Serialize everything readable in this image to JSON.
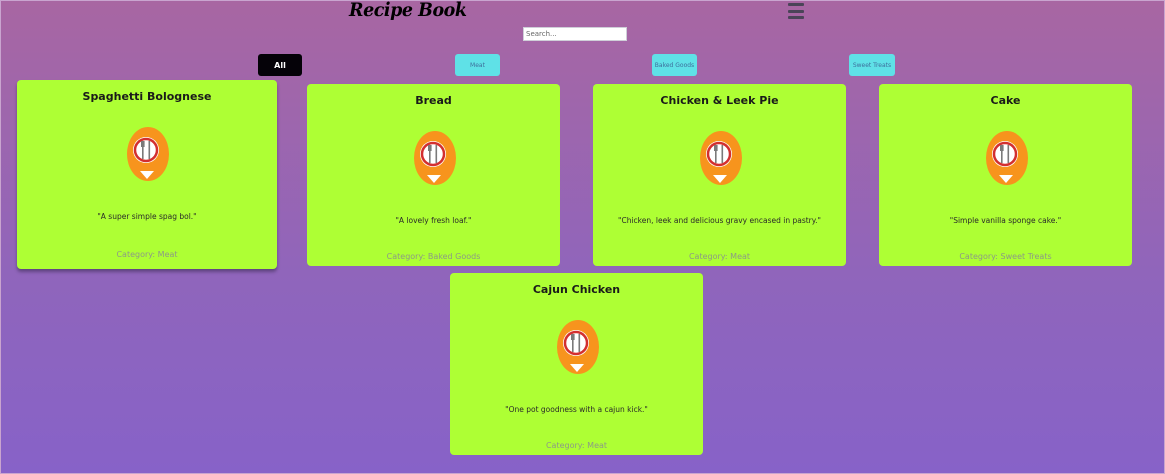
{
  "header": {
    "title": "Recipe Book",
    "menu_icon": "hamburger-menu-icon"
  },
  "search": {
    "placeholder": "Search...",
    "value": ""
  },
  "filters": [
    {
      "label": "All",
      "active": true
    },
    {
      "label": "Meat",
      "active": false
    },
    {
      "label": "Baked Goods",
      "active": false
    },
    {
      "label": "Sweet Treats",
      "active": false
    }
  ],
  "recipes": [
    {
      "name": "Spaghetti Bolognese",
      "description": "\"A super simple spag bol.\"",
      "category": "Category: Meat",
      "icon": "plate-cutlery-pin-icon"
    },
    {
      "name": "Bread",
      "description": "\"A lovely fresh loaf.\"",
      "category": "Category: Baked Goods",
      "icon": "plate-cutlery-pin-icon"
    },
    {
      "name": "Chicken & Leek Pie",
      "description": "\"Chicken, leek and delicious gravy encased in pastry.\"",
      "category": "Category: Meat",
      "icon": "plate-cutlery-pin-icon"
    },
    {
      "name": "Cake",
      "description": "\"Simple vanilla sponge cake.\"",
      "category": "Category: Sweet Treats",
      "icon": "plate-cutlery-pin-icon"
    },
    {
      "name": "Cajun Chicken",
      "description": "\"One pot goodness with a cajun kick.\"",
      "category": "Category: Meat",
      "icon": "plate-cutlery-pin-icon"
    }
  ],
  "colors": {
    "card_background": "#aeff34",
    "active_filter": "#050208",
    "inactive_filter": "#5fe1e7",
    "icon_orange": "#f7941d",
    "icon_red": "#d32f2f"
  }
}
